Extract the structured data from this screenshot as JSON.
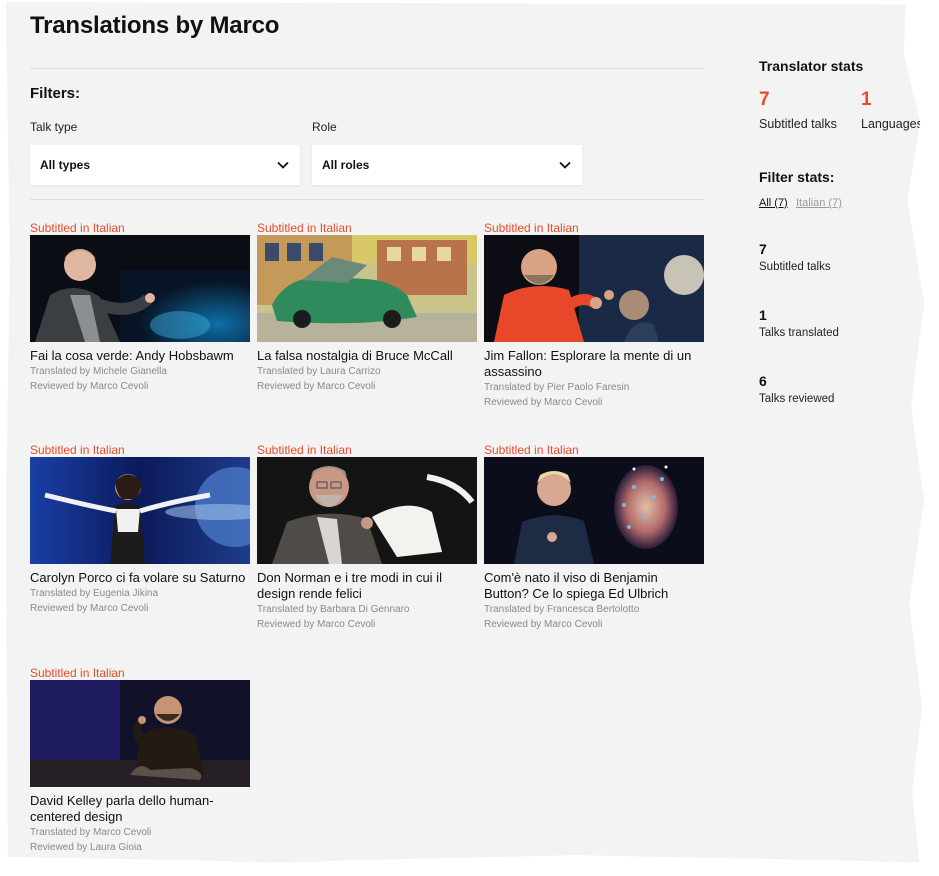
{
  "page": {
    "title": "Translations by Marco"
  },
  "filters": {
    "heading": "Filters:",
    "talk_type": {
      "label": "Talk type",
      "value": "All types"
    },
    "role": {
      "label": "Role",
      "value": "All roles"
    }
  },
  "talks": [
    {
      "subtitle": "Subtitled in Italian",
      "title": "Fai la cosa verde: Andy Hobsbawm",
      "translated": "Translated by Michele Gianella",
      "reviewed": "Reviewed by Marco Cevoli"
    },
    {
      "subtitle": "Subtitled in Italian",
      "title": "La falsa nostalgia di Bruce McCall",
      "translated": "Translated by Laura Carrizo",
      "reviewed": "Reviewed by Marco Cevoli"
    },
    {
      "subtitle": "Subtitled in Italian",
      "title": "Jim Fallon: Esplorare la mente di un assassino",
      "translated": "Translated by Pier Paolo Faresin",
      "reviewed": "Reviewed by Marco Cevoli"
    },
    {
      "subtitle": "Subtitled in Italian",
      "title": "Carolyn Porco ci fa volare su Saturno",
      "translated": "Translated by Eugenia Jikina",
      "reviewed": "Reviewed by Marco Cevoli"
    },
    {
      "subtitle": "Subtitled in Italian",
      "title": "Don Norman e i tre modi in cui il design rende felici",
      "translated": "Translated by Barbara Di Gennaro",
      "reviewed": "Reviewed by Marco Cevoli"
    },
    {
      "subtitle": "Subtitled in Italian",
      "title": "Com'è nato il viso di Benjamin Button? Ce lo spiega Ed Ulbrich",
      "translated": "Translated by Francesca Bertolotto",
      "reviewed": "Reviewed by Marco Cevoli"
    },
    {
      "subtitle": "Subtitled in Italian",
      "title": "David Kelley parla dello human-centered design",
      "translated": "Translated by Marco Cevoli",
      "reviewed": "Reviewed by Laura Gioia"
    }
  ],
  "translator_stats": {
    "heading": "Translator stats",
    "subtitled_count": "7",
    "subtitled_label": "Subtitled talks",
    "languages_count": "1",
    "languages_label": "Languages"
  },
  "filter_stats": {
    "heading": "Filter stats:",
    "links": [
      "All (7)",
      "Italian (7)"
    ],
    "items": [
      {
        "num": "7",
        "label": "Subtitled talks"
      },
      {
        "num": "1",
        "label": "Talks translated"
      },
      {
        "num": "6",
        "label": "Talks reviewed"
      }
    ]
  },
  "colors": {
    "accent": "#e74c2c",
    "background": "#f3f3f3"
  }
}
